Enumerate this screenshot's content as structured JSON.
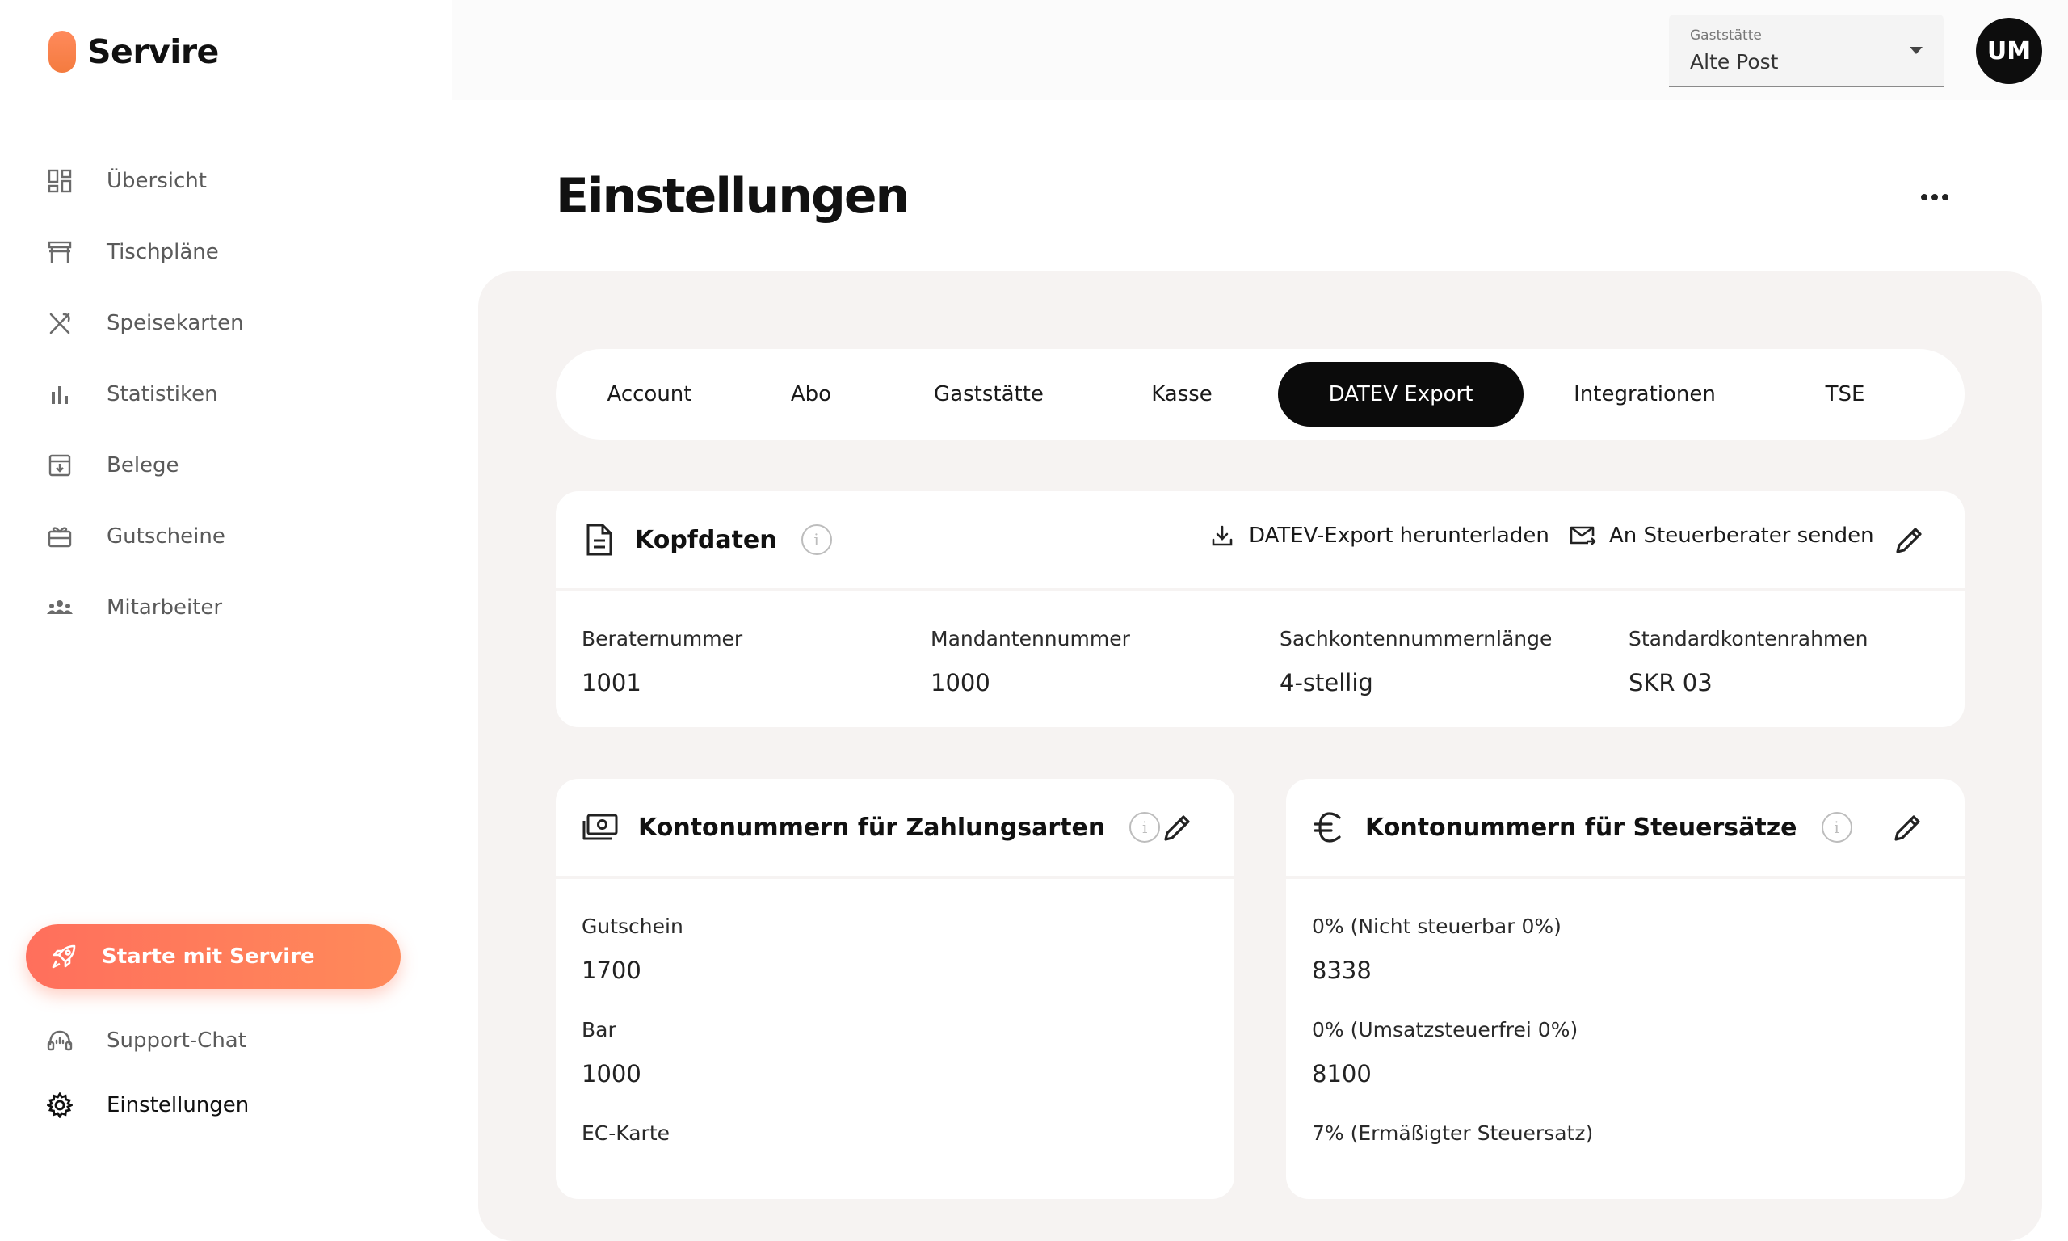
{
  "brand": {
    "name": "Servire",
    "accent": "#ff7a5a"
  },
  "sidebar": {
    "items": [
      {
        "label": "Übersicht",
        "icon": "dashboard-grid-icon"
      },
      {
        "label": "Tischpläne",
        "icon": "table-icon"
      },
      {
        "label": "Speisekarten",
        "icon": "utensils-icon"
      },
      {
        "label": "Statistiken",
        "icon": "bar-chart-icon"
      },
      {
        "label": "Belege",
        "icon": "receipt-download-icon"
      },
      {
        "label": "Gutscheine",
        "icon": "gift-icon"
      },
      {
        "label": "Mitarbeiter",
        "icon": "team-icon"
      }
    ],
    "cta": {
      "label": "Starte mit Servire",
      "icon": "rocket-icon"
    },
    "bottom": [
      {
        "label": "Support-Chat",
        "icon": "headset-icon"
      },
      {
        "label": "Einstellungen",
        "icon": "gear-icon",
        "active": true
      }
    ]
  },
  "header": {
    "venue_label": "Gaststätte",
    "venue_value": "Alte Post",
    "avatar_initials": "UM"
  },
  "page": {
    "title": "Einstellungen"
  },
  "tabs": [
    {
      "label": "Account"
    },
    {
      "label": "Abo"
    },
    {
      "label": "Gaststätte"
    },
    {
      "label": "Kasse"
    },
    {
      "label": "DATEV Export",
      "active": true
    },
    {
      "label": "Integrationen"
    },
    {
      "label": "TSE"
    }
  ],
  "kopfdaten": {
    "title": "Kopfdaten",
    "download_label": "DATEV-Export herunterladen",
    "send_label": "An Steuerberater senden",
    "fields": [
      {
        "label": "Beraternummer",
        "value": "1001"
      },
      {
        "label": "Mandantennummer",
        "value": "1000"
      },
      {
        "label": "Sachkontennummernlänge",
        "value": "4-stellig"
      },
      {
        "label": "Standardkontenrahmen",
        "value": "SKR 03"
      }
    ]
  },
  "zahlungsarten": {
    "title": "Kontonummern für Zahlungsarten",
    "fields": [
      {
        "label": "Gutschein",
        "value": "1700"
      },
      {
        "label": "Bar",
        "value": "1000"
      },
      {
        "label": "EC-Karte",
        "value": ""
      }
    ]
  },
  "steuersaetze": {
    "title": "Kontonummern für Steuersätze",
    "fields": [
      {
        "label": "0% (Nicht steuerbar 0%)",
        "value": "8338"
      },
      {
        "label": "0% (Umsatzsteuerfrei 0%)",
        "value": "8100"
      },
      {
        "label": "7% (Ermäßigter Steuersatz)",
        "value": ""
      }
    ]
  }
}
